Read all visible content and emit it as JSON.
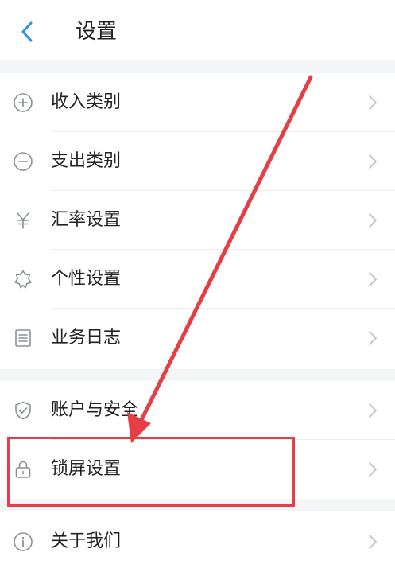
{
  "header": {
    "title": "设置"
  },
  "groups": [
    {
      "items": [
        {
          "label": "收入类别",
          "icon": "plus-circle-icon"
        },
        {
          "label": "支出类别",
          "icon": "minus-circle-icon"
        },
        {
          "label": "汇率设置",
          "icon": "yen-icon"
        },
        {
          "label": "个性设置",
          "icon": "star-badge-icon"
        },
        {
          "label": "业务日志",
          "icon": "list-icon"
        }
      ]
    },
    {
      "items": [
        {
          "label": "账户与安全",
          "icon": "shield-check-icon"
        },
        {
          "label": "锁屏设置",
          "icon": "lock-icon"
        }
      ]
    },
    {
      "items": [
        {
          "label": "关于我们",
          "icon": "info-icon"
        }
      ]
    }
  ],
  "colors": {
    "accent": "#2f8fe8",
    "annotation": "#e53e46",
    "icon": "#8a8f98",
    "chevron": "#c4c7cc"
  }
}
